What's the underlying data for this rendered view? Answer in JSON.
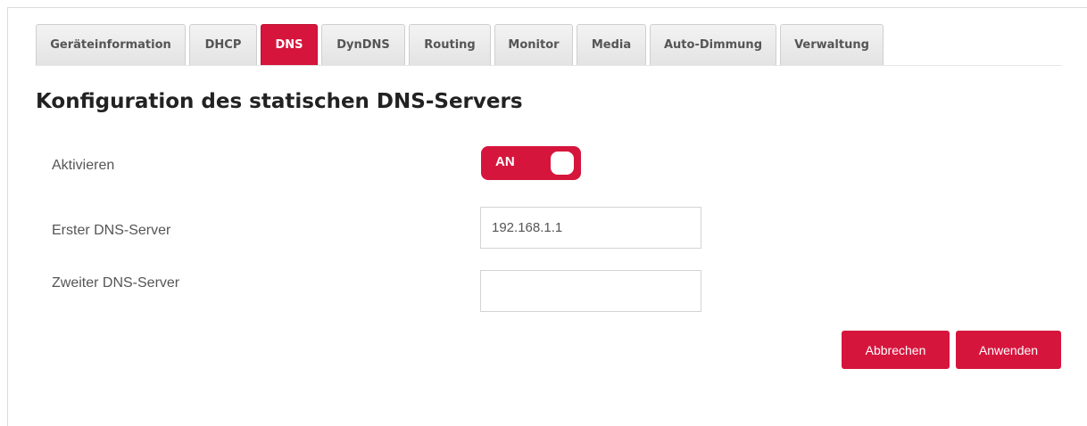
{
  "tabs": [
    {
      "label": "Geräteinformation",
      "active": false
    },
    {
      "label": "DHCP",
      "active": false
    },
    {
      "label": "DNS",
      "active": true
    },
    {
      "label": "DynDNS",
      "active": false
    },
    {
      "label": "Routing",
      "active": false
    },
    {
      "label": "Monitor",
      "active": false
    },
    {
      "label": "Media",
      "active": false
    },
    {
      "label": "Auto-Dimmung",
      "active": false
    },
    {
      "label": "Verwaltung",
      "active": false
    }
  ],
  "page": {
    "title": "Konfiguration des statischen DNS-Servers"
  },
  "form": {
    "enable_label": "Aktivieren",
    "enable_toggle_text": "AN",
    "enable_state": true,
    "first_dns_label": "Erster DNS-Server",
    "first_dns_value": "192.168.1.1",
    "second_dns_label": "Zweiter DNS-Server",
    "second_dns_value": ""
  },
  "actions": {
    "cancel_label": "Abbrechen",
    "apply_label": "Anwenden"
  },
  "colors": {
    "accent": "#d6153d",
    "tab_inactive": "#e8e8e8",
    "text": "#555555",
    "title": "#222222"
  }
}
